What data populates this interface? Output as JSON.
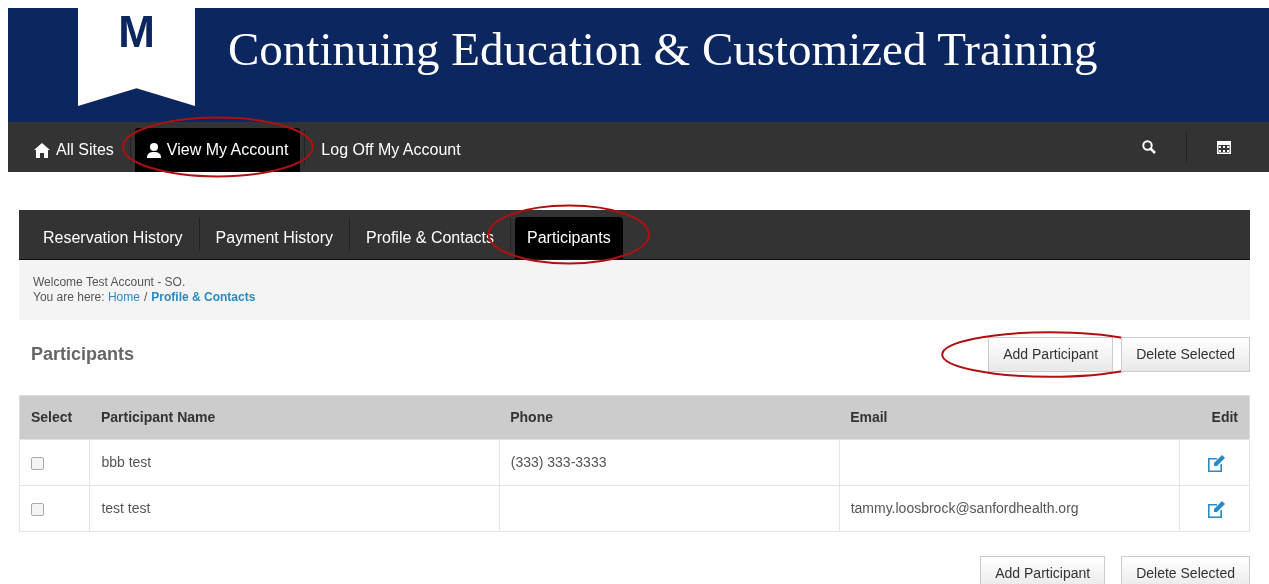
{
  "header": {
    "logo_letter": "M",
    "title": "Continuing Education & Customized Training"
  },
  "top_nav": [
    {
      "label": "All Sites",
      "selected": false,
      "circled": false
    },
    {
      "label": "View My Account",
      "selected": true,
      "circled": true
    },
    {
      "label": "Log Off My Account",
      "selected": false,
      "circled": false
    }
  ],
  "tabs": [
    {
      "label": "Reservation History",
      "selected": false,
      "circled": false
    },
    {
      "label": "Payment History",
      "selected": false,
      "circled": false
    },
    {
      "label": "Profile & Contacts",
      "selected": false,
      "circled": false
    },
    {
      "label": "Participants",
      "selected": true,
      "circled": true
    }
  ],
  "welcome": "Welcome Test Account - SO.",
  "breadcrumb": {
    "prefix": "You are here:",
    "separator": "/",
    "links": [
      "Home",
      "Profile & Contacts"
    ]
  },
  "page_title": "Participants",
  "top_buttons": [
    {
      "label": "Add Participant",
      "circled": true
    },
    {
      "label": "Delete Selected",
      "circled": false
    }
  ],
  "table": {
    "columns": [
      "Select",
      "Participant Name",
      "Phone",
      "Email",
      "Edit"
    ],
    "rows": [
      {
        "checked": false,
        "name": "bbb test",
        "phone": "(333) 333-3333",
        "email": ""
      },
      {
        "checked": false,
        "name": "test test",
        "phone": "",
        "email": "tammy.loosbrock@sanfordhealth.org"
      }
    ]
  },
  "bottom_buttons": [
    {
      "label": "Add Participant",
      "circled": false
    },
    {
      "label": "Delete Selected",
      "circled": false
    }
  ]
}
